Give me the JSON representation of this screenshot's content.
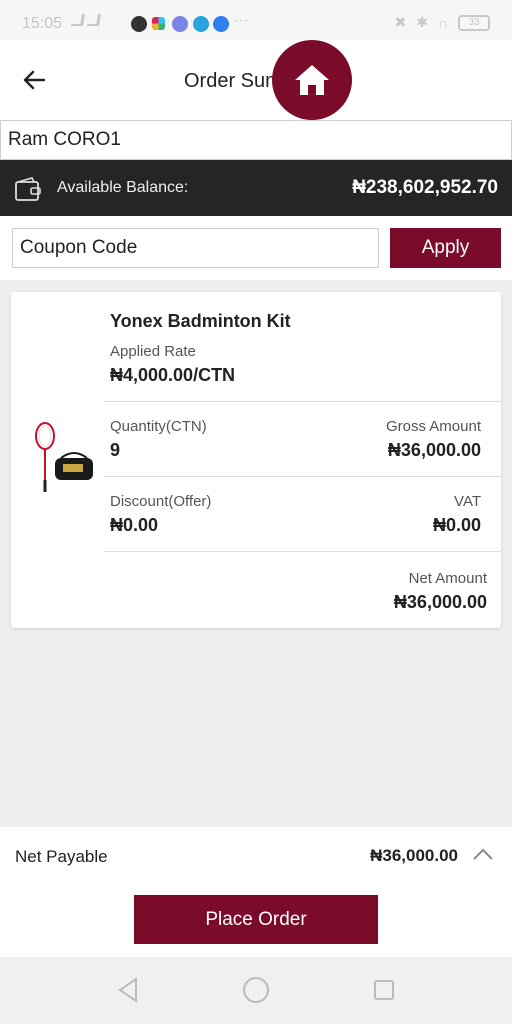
{
  "status_bar": {
    "time": "15:05",
    "battery": "33"
  },
  "header": {
    "title": "Order Summary"
  },
  "customer": {
    "name": "Ram CORO1"
  },
  "balance": {
    "label": "Available Balance:",
    "value": "₦238,602,952.70"
  },
  "coupon": {
    "placeholder": "Coupon Code",
    "apply_label": "Apply"
  },
  "item": {
    "name": "Yonex Badminton Kit",
    "rate_label": "Applied Rate",
    "rate_value": "₦4,000.00/CTN",
    "qty_label": "Quantity(CTN)",
    "qty_value": "9",
    "gross_label": "Gross Amount",
    "gross_value": "₦36,000.00",
    "discount_label": "Discount(Offer)",
    "discount_value": "₦0.00",
    "vat_label": "VAT",
    "vat_value": "₦0.00",
    "net_label": "Net Amount",
    "net_value": "₦36,000.00"
  },
  "footer": {
    "net_payable_label": "Net Payable",
    "net_payable_value": "₦36,000.00",
    "place_order_label": "Place Order"
  },
  "colors": {
    "accent": "#7b0b2b",
    "balance_bar": "#252525"
  }
}
